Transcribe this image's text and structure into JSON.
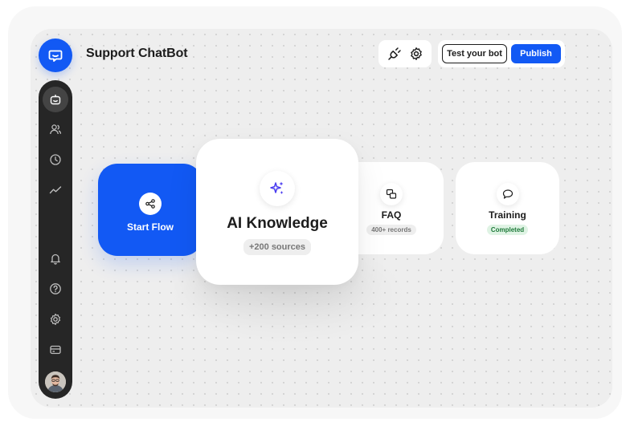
{
  "header": {
    "title": "Support ChatBot",
    "test_label": "Test your bot",
    "publish_label": "Publish"
  },
  "sidebar": {
    "items": [
      {
        "icon": "bot-icon",
        "active": true
      },
      {
        "icon": "users-icon",
        "active": false
      },
      {
        "icon": "clock-icon",
        "active": false
      },
      {
        "icon": "analytics-icon",
        "active": false
      },
      {
        "icon": "bell-icon",
        "active": false
      },
      {
        "icon": "help-icon",
        "active": false
      },
      {
        "icon": "gear-icon",
        "active": false
      },
      {
        "icon": "billing-icon",
        "active": false
      }
    ]
  },
  "cards": {
    "start": {
      "label": "Start Flow"
    },
    "ai": {
      "label": "AI Knowledge",
      "badge": "+200 sources"
    },
    "faq": {
      "label": "FAQ",
      "badge": "400+ records"
    },
    "training": {
      "label": "Training",
      "badge": "Completed"
    }
  },
  "colors": {
    "accent": "#1259f4",
    "success_bg": "#dff3e4",
    "success_text": "#1f7a3a",
    "sparkle": "#4a3cf0"
  }
}
